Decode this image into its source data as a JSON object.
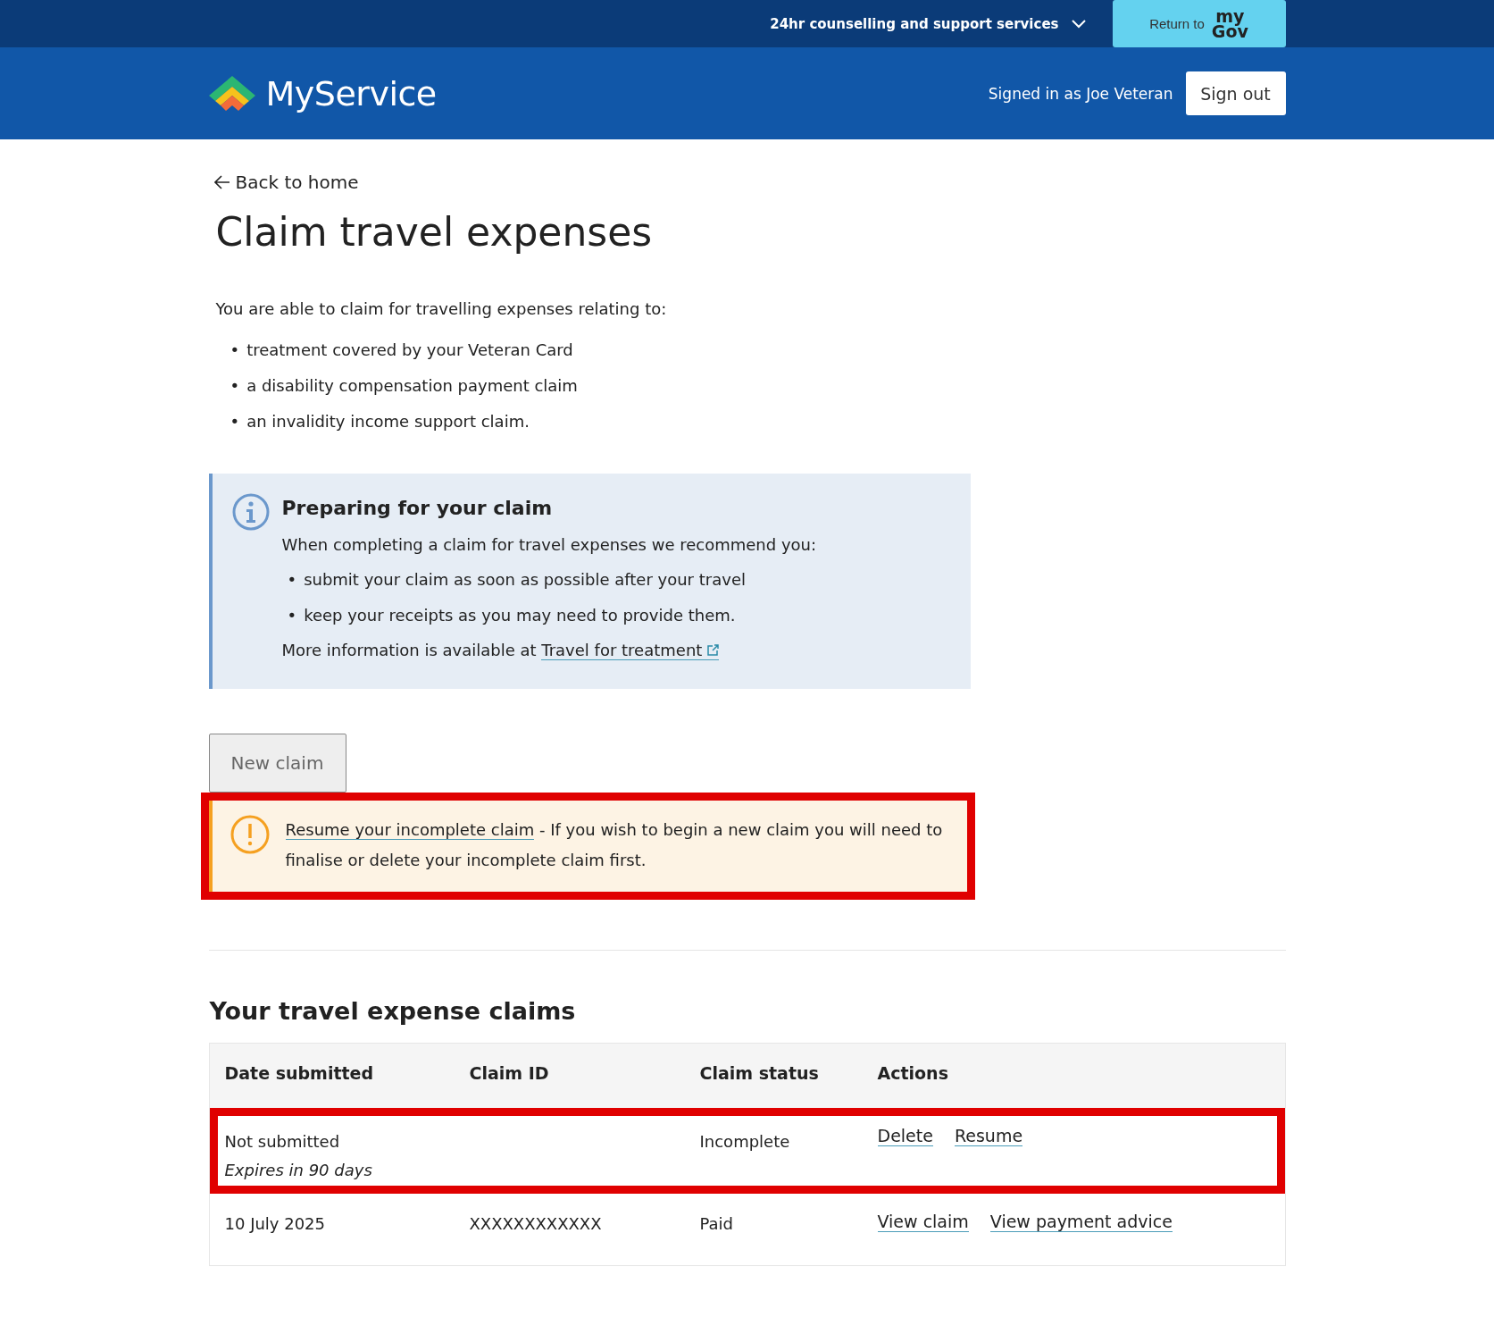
{
  "top_bar": {
    "support_menu": "24hr counselling and support services",
    "return_label": "Return to",
    "return_logo": [
      "my",
      "Gov"
    ]
  },
  "header": {
    "brand": "MyService",
    "signed_in": "Signed in as Joe Veteran",
    "sign_out": "Sign out"
  },
  "back_link": "Back to home",
  "title": "Claim travel expenses",
  "bullet": "•",
  "intro": "You are able to claim for travelling expenses relating to:",
  "intro_items": [
    "treatment covered by your Veteran Card",
    "a disability compensation payment claim",
    "an invalidity income support claim."
  ],
  "info_box": {
    "title": "Preparing for your claim",
    "lead": "When completing a claim for travel expenses we recommend you:",
    "items": [
      "submit your claim as soon as possible after your travel",
      "keep your receipts as you may need to provide them."
    ],
    "more_text": "More information is available at",
    "link": "Travel for treatment"
  },
  "new_claim_button": {
    "label": "New claim",
    "disabled": true
  },
  "warning": {
    "link": "Resume your incomplete claim",
    "text": "- If you wish to begin a new claim you will need to finalise or delete your incomplete claim first.",
    "highlighted": true
  },
  "claims": {
    "title": "Your travel expense claims",
    "columns": [
      "Date submitted",
      "Claim ID",
      "Claim status",
      "Actions"
    ],
    "rows": [
      {
        "date": "Not submitted",
        "note": "Expires in 90 days",
        "status": "Incomplete",
        "actions": [
          "Delete",
          "Resume"
        ],
        "highlighted": true
      },
      {
        "date": "10 July 2025",
        "claim_id": "XXXXXXXXXXXX",
        "status": "Paid",
        "actions": [
          "View claim",
          "View payment advice"
        ],
        "highlighted": false
      }
    ]
  }
}
